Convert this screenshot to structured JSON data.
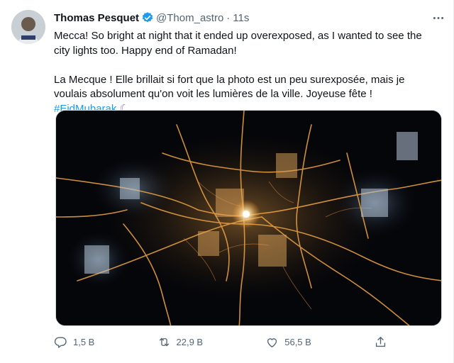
{
  "tweet": {
    "author": {
      "display_name": "Thomas Pesquet",
      "handle": "@Thom_astro",
      "verified": true
    },
    "separator": "·",
    "timestamp": "11s",
    "text_en": "Mecca! So bright at night that it ended up overexposed, as I wanted to see the city lights too. Happy end of Ramadan!",
    "text_fr": "La Mecque ! Elle brillait si fort que la photo est un peu surexposée, mais je voulais absolument qu'on voit les lumières de la ville. Joyeuse fête ! ",
    "hashtag": "#EidMubarak",
    "emoji": "☾",
    "accent_color": "#1d9bf0"
  },
  "actions": {
    "reply_count": "1,5 B",
    "retweet_count": "22,9 B",
    "like_count": "56,5 B"
  },
  "icons": [
    "verified-badge-icon",
    "more-icon",
    "reply-icon",
    "retweet-icon",
    "like-icon",
    "share-icon",
    "crescent-moon-icon"
  ]
}
